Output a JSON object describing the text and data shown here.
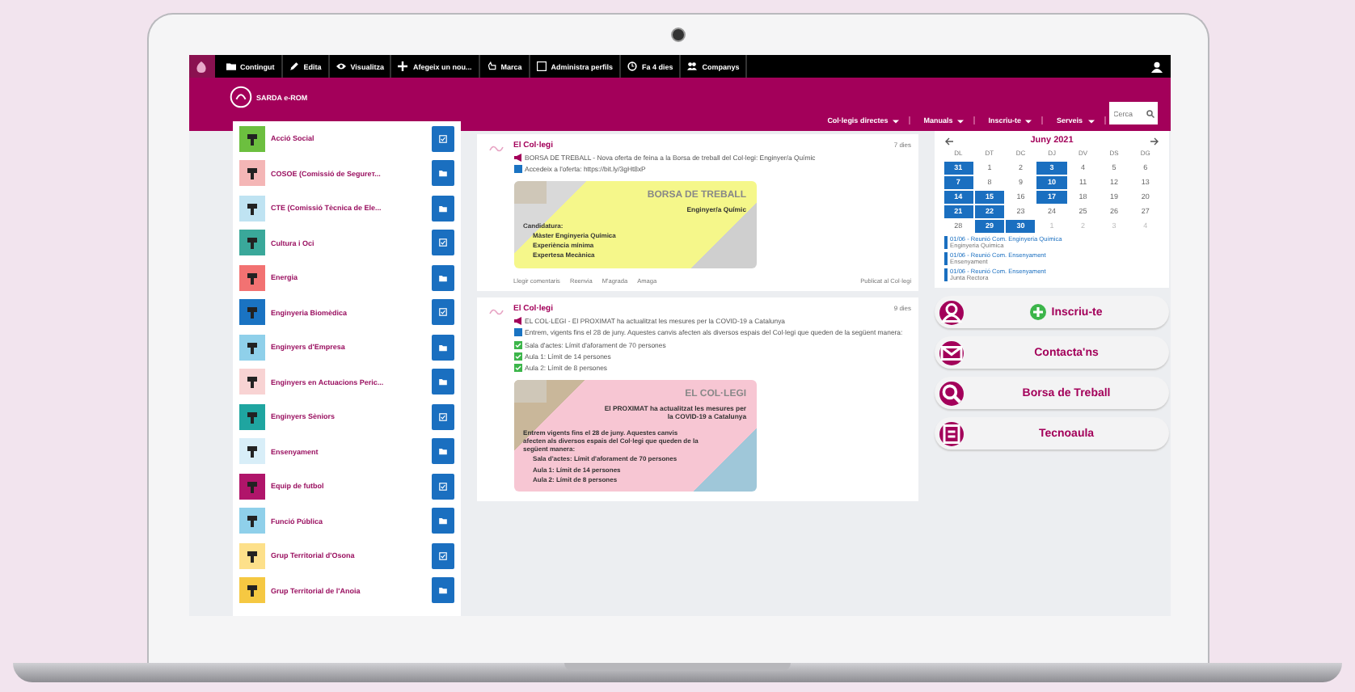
{
  "toolbar": {
    "items": [
      {
        "label": "Contingut",
        "kind": "folder"
      },
      {
        "label": "Edita",
        "kind": "pencil"
      },
      {
        "label": "Visualitza",
        "kind": "eye"
      },
      {
        "label": "Afegeix un nou...",
        "kind": "plus"
      },
      {
        "label": "Marca",
        "kind": "hand"
      },
      {
        "label": "Administra perfils",
        "kind": "window"
      },
      {
        "label": "Fa 4 dies",
        "kind": "clock"
      },
      {
        "label": "Companys",
        "kind": "people"
      }
    ]
  },
  "header": {
    "site_name": "SARDA e-ROM",
    "nav": [
      "Col·legis directes",
      "Manuals",
      "Inscriu-te",
      "Serveis"
    ],
    "search": {
      "placeholder": "Cerca"
    }
  },
  "sidebar": {
    "items": [
      {
        "label": "Acció Social",
        "color": "#6cbf3f",
        "kind": "check"
      },
      {
        "label": "COSOE (Comissió de Segureт...",
        "color": "#f4b6b6",
        "kind": "folder"
      },
      {
        "label": "CTE (Comissió Tècnica de Ele...",
        "color": "#bfe3f2",
        "kind": "folder"
      },
      {
        "label": "Cultura i Oci",
        "color": "#3aa89a",
        "kind": "check"
      },
      {
        "label": "Energia",
        "color": "#f27272",
        "kind": "folder"
      },
      {
        "label": "Enginyeria Biomèdica",
        "color": "#1a73c2",
        "kind": "check"
      },
      {
        "label": "Enginyers d'Empresa",
        "color": "#8fd0ea",
        "kind": "folder"
      },
      {
        "label": "Enginyers en Actuacions Peric...",
        "color": "#f8d3d3",
        "kind": "folder"
      },
      {
        "label": "Enginyers Sèniors",
        "color": "#1fa5a0",
        "kind": "check"
      },
      {
        "label": "Ensenyament",
        "color": "#d8eef8",
        "kind": "folder"
      },
      {
        "label": "Equip de futbol",
        "color": "#b0156a",
        "kind": "check"
      },
      {
        "label": "Funció Pública",
        "color": "#8fd0ea",
        "kind": "folder"
      },
      {
        "label": "Grup Territorial d'Osona",
        "color": "#fde08a",
        "kind": "check"
      },
      {
        "label": "Grup Territorial de l'Anoia",
        "color": "#f5c842",
        "kind": "folder"
      }
    ]
  },
  "feed": {
    "posts": [
      {
        "author": "El Col·legi",
        "time": "7 dies",
        "headline": "BORSA DE TREBALL - Nova oferta de feina a la Borsa de treball del Col·legi: Enginyer/a Químic",
        "paragraph": "Accedeix a l'oferta: https://bit.ly/3gHt8xP",
        "graphic": {
          "kind": "yellow",
          "title": "BORSA DE TREBALL",
          "subtitle": "Enginyer/a Químic",
          "text": "Candidatura:",
          "bullets": [
            "Màster Enginyeria Química",
            "Experiència mínima",
            "Expertesa Mecànica"
          ]
        },
        "actions": [
          "Llegir comentaris",
          "Reenvia",
          "M'agrada",
          "Amaga"
        ],
        "source": "Publicat al Col·legi"
      },
      {
        "author": "El Col·legi",
        "time": "9 dies",
        "headline": "EL COL·LEGI - El PROXIMAT ha actualitzat les mesures per la COVID-19 a Catalunya",
        "paragraph": "Entrem, vigents fins el 28 de juny. Aquestes canvis afecten als diversos espais del Col·legi que queden de la següent manera:",
        "checklist": [
          "Sala d'actes: Límit d'aforament de 70 persones",
          "Aula 1: Límit de 14 persones",
          "Aula 2: Límit de 8 persones"
        ],
        "graphic": {
          "kind": "pink",
          "title": "EL COL·LEGI",
          "subtitle": "El PROXIMAT ha actualitzat les mesures per la COVID-19 a Catalunya",
          "text": "Entrem vigents fins el 28 de juny. Aquestes canvis afecten als diversos espais del Col·legi que queden de la següent manera:",
          "bullets": [
            "Sala d'actes: Límit d'aforament de 70 persones",
            "Aula 1: Límit de 14 persones",
            "Aula 2: Límit de 8 persones"
          ]
        }
      }
    ]
  },
  "calendar": {
    "month": "Juny 2021",
    "weekdays": [
      "DL",
      "DT",
      "DC",
      "DJ",
      "DV",
      "DS",
      "DG"
    ],
    "weeks": [
      [
        {
          "day": "31",
          "selected": true,
          "muted": false
        },
        {
          "day": "1",
          "selected": false,
          "muted": false
        },
        {
          "day": "2",
          "selected": false,
          "muted": false
        },
        {
          "day": "3",
          "selected": true,
          "muted": false
        },
        {
          "day": "4",
          "selected": false,
          "muted": false
        },
        {
          "day": "5",
          "selected": false,
          "muted": false
        },
        {
          "day": "6",
          "selected": false,
          "muted": false
        }
      ],
      [
        {
          "day": "7",
          "selected": true,
          "muted": false
        },
        {
          "day": "8",
          "selected": false,
          "muted": false
        },
        {
          "day": "9",
          "selected": false,
          "muted": false
        },
        {
          "day": "10",
          "selected": true,
          "muted": false
        },
        {
          "day": "11",
          "selected": false,
          "muted": false
        },
        {
          "day": "12",
          "selected": false,
          "muted": false
        },
        {
          "day": "13",
          "selected": false,
          "muted": false
        }
      ],
      [
        {
          "day": "14",
          "selected": true,
          "muted": false
        },
        {
          "day": "15",
          "selected": true,
          "muted": false
        },
        {
          "day": "16",
          "selected": false,
          "muted": false
        },
        {
          "day": "17",
          "selected": true,
          "muted": false
        },
        {
          "day": "18",
          "selected": false,
          "muted": false
        },
        {
          "day": "19",
          "selected": false,
          "muted": false
        },
        {
          "day": "20",
          "selected": false,
          "muted": false
        }
      ],
      [
        {
          "day": "21",
          "selected": true,
          "muted": false
        },
        {
          "day": "22",
          "selected": true,
          "muted": false
        },
        {
          "day": "23",
          "selected": false,
          "muted": false
        },
        {
          "day": "24",
          "selected": false,
          "muted": false
        },
        {
          "day": "25",
          "selected": false,
          "muted": false
        },
        {
          "day": "26",
          "selected": false,
          "muted": false
        },
        {
          "day": "27",
          "selected": false,
          "muted": false
        }
      ],
      [
        {
          "day": "28",
          "selected": false,
          "muted": false
        },
        {
          "day": "29",
          "selected": true,
          "muted": false
        },
        {
          "day": "30",
          "selected": true,
          "muted": false
        },
        {
          "day": "1",
          "selected": false,
          "muted": true
        },
        {
          "day": "2",
          "selected": false,
          "muted": true
        },
        {
          "day": "3",
          "selected": false,
          "muted": true
        },
        {
          "day": "4",
          "selected": false,
          "muted": true
        }
      ]
    ],
    "events": [
      {
        "title": "01/06 - Reunió Com. Enginyeria Química",
        "group": "Enginyeria Química"
      },
      {
        "title": "01/06 - Reunió Com. Ensenyament",
        "group": "Ensenyament"
      },
      {
        "title": "01/06 - Reunió Com. Ensenyament",
        "group": "Junta Rectora"
      }
    ]
  },
  "quick_links": [
    {
      "label": "Inscriu-te",
      "kind": "people",
      "plus": true
    },
    {
      "label": "Contacta'ns",
      "kind": "mail",
      "plus": false
    },
    {
      "label": "Borsa de Treball",
      "kind": "search",
      "plus": false
    },
    {
      "label": "Tecnoaula",
      "kind": "book",
      "plus": false
    }
  ]
}
